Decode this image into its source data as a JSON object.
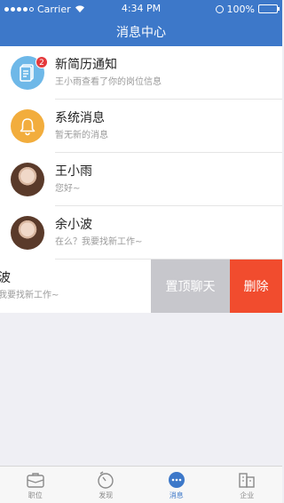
{
  "status_bar": {
    "carrier": "Carrier",
    "time": "4:34 PM",
    "battery": "100%"
  },
  "nav": {
    "title": "消息中心"
  },
  "messages": [
    {
      "title": "新简历通知",
      "subtitle": "王小雨查看了你的岗位信息",
      "icon": "document-icon",
      "badge": "2"
    },
    {
      "title": "系统消息",
      "subtitle": "暂无新的消息",
      "icon": "bell-icon"
    },
    {
      "title": "王小雨",
      "subtitle": "您好~",
      "icon": "avatar"
    },
    {
      "title": "余小波",
      "subtitle": "在么？我要找新工作~",
      "icon": "avatar"
    },
    {
      "title": "波",
      "subtitle": "我要找新工作~"
    }
  ],
  "swipe_actions": {
    "pin": "置顶聊天",
    "delete": "删除"
  },
  "tabs": [
    {
      "label": "职位",
      "icon": "briefcase-icon"
    },
    {
      "label": "发现",
      "icon": "compass-icon"
    },
    {
      "label": "消息",
      "icon": "chat-bubble-icon",
      "active": true
    },
    {
      "label": "企业",
      "icon": "building-icon"
    }
  ],
  "colors": {
    "brand": "#3d78c9",
    "delete": "#f14c2e",
    "pin": "#c7c7cc",
    "badge": "#e4393c"
  }
}
